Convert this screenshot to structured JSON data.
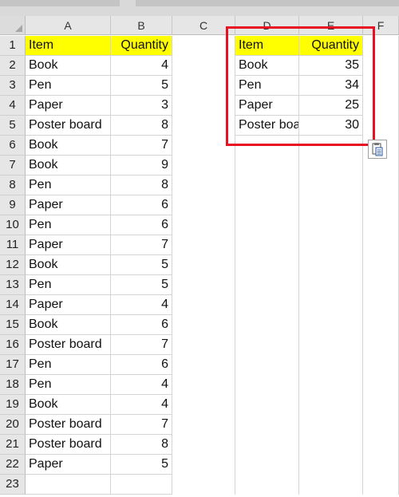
{
  "columns": [
    "A",
    "B",
    "C",
    "D",
    "E",
    "F"
  ],
  "rows": [
    "1",
    "2",
    "3",
    "4",
    "5",
    "6",
    "7",
    "8",
    "9",
    "10",
    "11",
    "12",
    "13",
    "14",
    "15",
    "16",
    "17",
    "18",
    "19",
    "20",
    "21",
    "22",
    "23"
  ],
  "source_table": {
    "header": {
      "item": "Item",
      "quantity": "Quantity"
    },
    "rows": [
      {
        "item": "Book",
        "quantity": "4"
      },
      {
        "item": "Pen",
        "quantity": "5"
      },
      {
        "item": "Paper",
        "quantity": "3"
      },
      {
        "item": "Poster board",
        "quantity": "8"
      },
      {
        "item": "Book",
        "quantity": "7"
      },
      {
        "item": "Book",
        "quantity": "9"
      },
      {
        "item": "Pen",
        "quantity": "8"
      },
      {
        "item": "Paper",
        "quantity": "6"
      },
      {
        "item": "Pen",
        "quantity": "6"
      },
      {
        "item": "Paper",
        "quantity": "7"
      },
      {
        "item": "Book",
        "quantity": "5"
      },
      {
        "item": "Pen",
        "quantity": "5"
      },
      {
        "item": "Paper",
        "quantity": "4"
      },
      {
        "item": "Book",
        "quantity": "6"
      },
      {
        "item": "Poster board",
        "quantity": "7"
      },
      {
        "item": "Pen",
        "quantity": "6"
      },
      {
        "item": "Pen",
        "quantity": "4"
      },
      {
        "item": "Book",
        "quantity": "4"
      },
      {
        "item": "Poster board",
        "quantity": "7"
      },
      {
        "item": "Poster board",
        "quantity": "8"
      },
      {
        "item": "Paper",
        "quantity": "5"
      }
    ]
  },
  "summary_table": {
    "header": {
      "item": "Item",
      "quantity": "Quantity"
    },
    "rows": [
      {
        "item": "Book",
        "quantity": "35"
      },
      {
        "item": "Pen",
        "quantity": "34"
      },
      {
        "item": "Paper",
        "quantity": "25"
      },
      {
        "item": "Poster board",
        "quantity": "30"
      }
    ]
  },
  "colors": {
    "header_fill": "#ffff00",
    "highlight_border": "#e81123",
    "grid_line": "#d4d4d4"
  },
  "icons": {
    "paste_options": "paste-options-icon"
  }
}
